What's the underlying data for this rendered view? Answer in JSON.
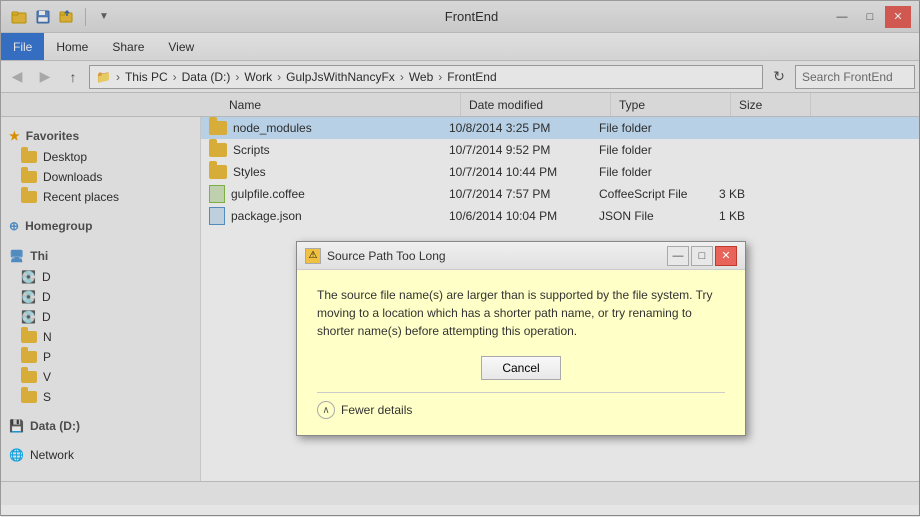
{
  "window": {
    "title": "FrontEnd"
  },
  "titlebar": {
    "icons": [
      "folder-icon",
      "save-icon",
      "folder-up-icon"
    ],
    "sep": "|",
    "controls": {
      "minimize": "—",
      "maximize": "□",
      "close": "✕"
    }
  },
  "menubar": {
    "items": [
      {
        "label": "File",
        "active": true
      },
      {
        "label": "Home",
        "active": false
      },
      {
        "label": "Share",
        "active": false
      },
      {
        "label": "View",
        "active": false
      }
    ]
  },
  "addressbar": {
    "back": "◀",
    "forward": "▶",
    "up": "↑",
    "path": [
      {
        "label": "📁",
        "crumb": ""
      },
      {
        "label": "This PC"
      },
      {
        "label": "Data (D:)"
      },
      {
        "label": "Work"
      },
      {
        "label": "GulpJsWithNancyFx"
      },
      {
        "label": "Web"
      },
      {
        "label": "FrontEnd"
      }
    ],
    "refresh": "↻",
    "search_placeholder": "Search FrontEnd"
  },
  "columns": [
    {
      "label": "Name",
      "class": "col-name"
    },
    {
      "label": "Date modified",
      "class": "col-date"
    },
    {
      "label": "Type",
      "class": "col-type"
    },
    {
      "label": "Size",
      "class": "col-size"
    }
  ],
  "sidebar": {
    "sections": [
      {
        "header": "Favorites",
        "icon": "star",
        "items": [
          {
            "label": "Desktop",
            "icon": "folder"
          },
          {
            "label": "Downloads",
            "icon": "folder"
          },
          {
            "label": "Recent places",
            "icon": "folder"
          }
        ]
      },
      {
        "header": "Homegroup",
        "icon": "network",
        "items": []
      },
      {
        "header": "This",
        "icon": "computer",
        "items": [
          {
            "label": "D"
          },
          {
            "label": "D"
          },
          {
            "label": "D"
          },
          {
            "label": "N"
          },
          {
            "label": "P"
          },
          {
            "label": "V"
          },
          {
            "label": "S"
          }
        ]
      },
      {
        "header": "Data (D:)",
        "icon": "drive",
        "items": []
      }
    ]
  },
  "files": [
    {
      "name": "node_modules",
      "date": "10/8/2014 3:25 PM",
      "type": "File folder",
      "size": "",
      "icon": "folder",
      "selected": true
    },
    {
      "name": "Scripts",
      "date": "10/7/2014 9:52 PM",
      "type": "File folder",
      "size": "",
      "icon": "folder"
    },
    {
      "name": "Styles",
      "date": "10/7/2014 10:44 PM",
      "type": "File folder",
      "size": "",
      "icon": "folder"
    },
    {
      "name": "gulpfile.coffee",
      "date": "10/7/2014 7:57 PM",
      "type": "CoffeeScript File",
      "size": "3 KB",
      "icon": "coffee"
    },
    {
      "name": "package.json",
      "date": "10/6/2014 10:04 PM",
      "type": "JSON File",
      "size": "1 KB",
      "icon": "json"
    }
  ],
  "statusbar": {
    "text": ""
  },
  "dialog": {
    "title": "Source Path Too Long",
    "icon": "warning",
    "message": "The source file name(s) are larger than is supported by the file system. Try moving to a location which has a shorter path name, or try renaming to shorter name(s) before attempting this operation.",
    "cancel_label": "Cancel",
    "details_label": "Fewer details",
    "minimize": "—",
    "maximize": "□",
    "close": "✕"
  },
  "network": {
    "label": "Network"
  }
}
